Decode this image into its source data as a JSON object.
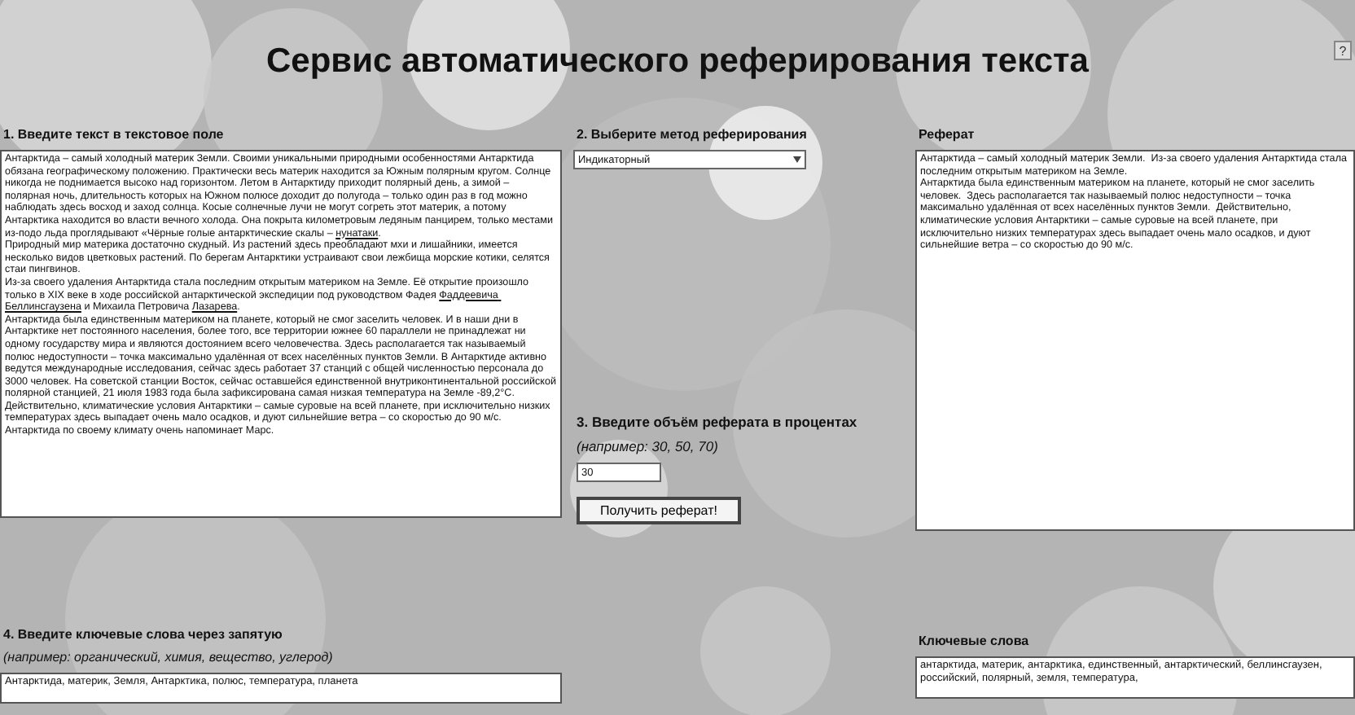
{
  "title": "Сервис автоматического реферирования текста",
  "help_button": "?",
  "text_input": {
    "label": "1. Введите текст в текстовое поле",
    "paragraphs": [
      {
        "segments": [
          {
            "text": "Антарктида – самый холодный материк Земли. Своими уникальными природными особенностями Антарктида обязана географическому положению. Практически весь материк находится за Южным полярным кругом. Солнце никогда не поднимается высоко над горизонтом. Летом в Антарктиду приходит полярный день, а зимой – полярная ночь, длительность которых на Южном полюсе доходит до полугода – только один раз в год можно наблюдать здесь восход и заход солнца. Косые солнечные лучи не могут согреть этот материк, а потому Антарктика находится во власти вечного холода. Она покрыта километровым ледяным панцирем, только местами из-подо льда проглядывают «Чёрные голые антарктические скалы – ",
            "underlined": false
          },
          {
            "text": "нунатаки",
            "underlined": true
          },
          {
            "text": ".",
            "underlined": false
          }
        ]
      },
      {
        "segments": [
          {
            "text": "Природный мир материка достаточно скудный. Из растений здесь преобладают мхи и лишайники, имеется несколько видов цветковых растений. По берегам Антарктики устраивают свои лежбища морские котики, селятся стаи пингвинов.",
            "underlined": false
          }
        ]
      },
      {
        "segments": [
          {
            "text": "Из-за своего удаления Антарктида стала последним открытым материком на Земле. Её открытие произошло только в XIX веке в ходе российской антарктической экспедиции под руководством Фадея ",
            "underlined": false
          },
          {
            "text": "Фаддеевича Беллинсгаузена",
            "underlined": true
          },
          {
            "text": " и Михаила Петровича ",
            "underlined": false
          },
          {
            "text": "Лазарева",
            "underlined": true
          },
          {
            "text": ".",
            "underlined": false
          }
        ]
      },
      {
        "segments": [
          {
            "text": "Антарктида была единственным материком на планете, который не смог заселить человек. И в наши дни в Антарктике нет постоянного населения, более того, все территории южнее 60 параллели не принадлежат ни одному государству мира и являются достоянием всего человечества. Здесь располагается так называемый полюс недоступности – точка максимально удалённая от всех населённых пунктов Земли. В Антарктиде активно ведутся международные исследования, сейчас здесь работает 37 станций с общей численностью персонала до 3000 человек. На советской станции Восток, сейчас оставшейся единственной внутриконтинентальной российской полярной станцией, 21 июля 1983 года была зафиксирована самая низкая температура на Земле -89,2°C.",
            "underlined": false
          }
        ]
      },
      {
        "segments": [
          {
            "text": "Действительно, климатические условия Антарктики – самые суровые на всей планете, при исключительно низких температурах здесь выпадает очень мало осадков, и дуют сильнейшие ветра – со скоростью до 90 м/с.",
            "underlined": false
          }
        ]
      },
      {
        "segments": [
          {
            "text": "Антарктида по своему климату очень напоминает Марс.",
            "underlined": false
          }
        ]
      }
    ]
  },
  "method": {
    "label": "2. Выберите метод реферирования",
    "value": "Индикаторный"
  },
  "volume": {
    "label": "3. Введите объём реферата в процентах",
    "hint": "(например: 30, 50, 70)",
    "value": "30"
  },
  "submit_button": "Получить реферат!",
  "summary": {
    "label": "Реферат",
    "text": "Антарктида – самый холодный материк Земли.  Из-за своего удаления Антарктида стала последним открытым материком на Земле.\nАнтарктида была единственным материком на планете, который не смог заселить человек.  Здесь располагается так называемый полюс недоступности – точка максимально удалённая от всех населённых пунктов Земли.  Действительно, климатические условия Антарктики – самые суровые на всей планете, при исключительно низких температурах здесь выпадает очень мало осадков, и дуют сильнейшие ветра – со скоростью до 90 м/с."
  },
  "keywords_input": {
    "label": "4. Введите ключевые слова через запятую",
    "hint": "(например: органический, химия, вещество, углерод)",
    "value": "Антарктида, материк, Земля, Антарктика, полюс, температура, планета"
  },
  "keywords_output": {
    "label": "Ключевые слова",
    "text": "антарктида, материк, антарктика, единственный, антарктический, беллинсгаузен, российский, полярный, земля, температура,"
  }
}
